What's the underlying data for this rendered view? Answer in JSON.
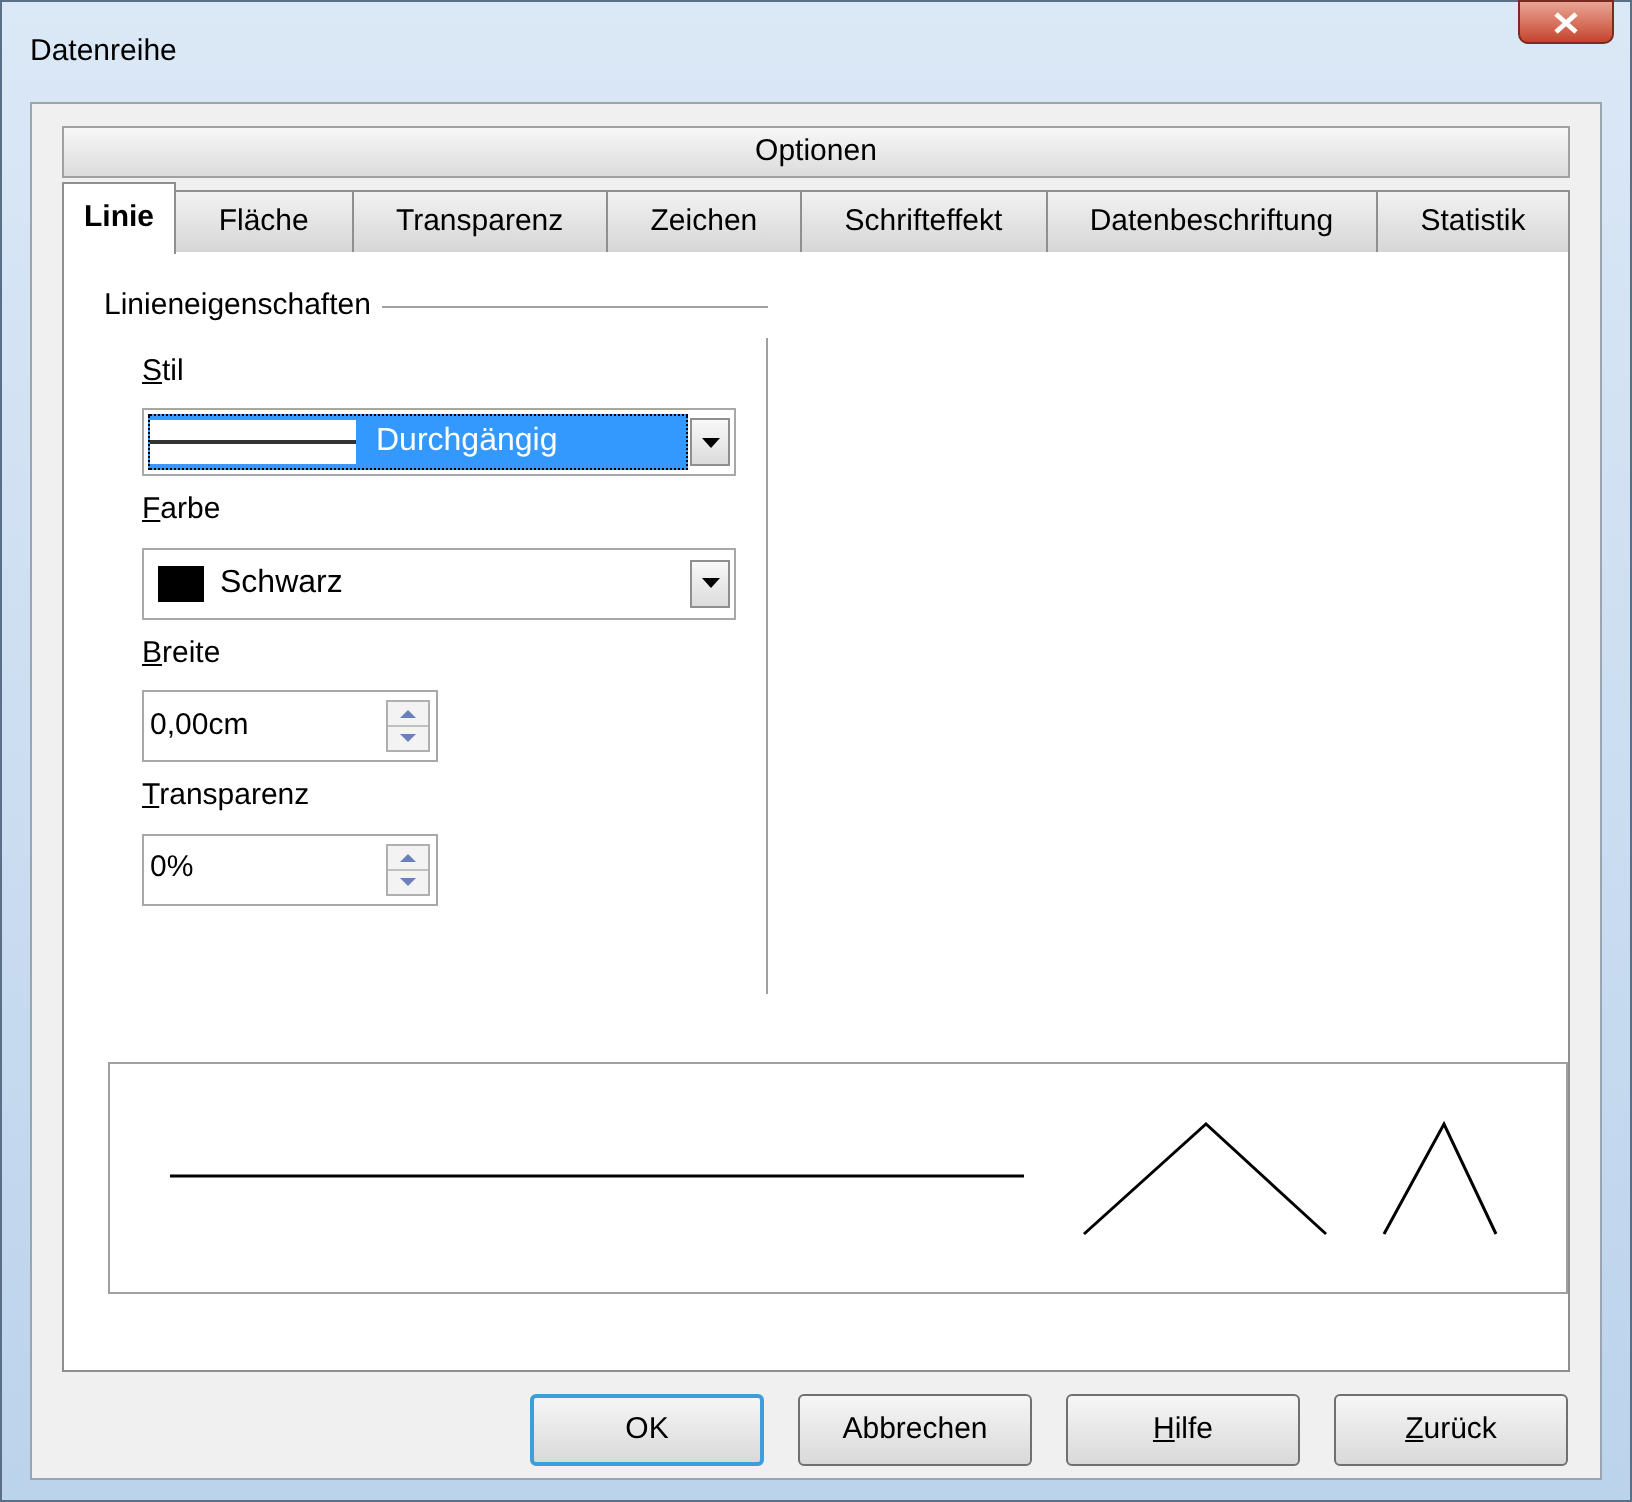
{
  "window": {
    "title": "Datenreihe"
  },
  "section_title": "Optionen",
  "tabs": [
    {
      "label": "Linie",
      "selected": true
    },
    {
      "label": "Fläche",
      "selected": false
    },
    {
      "label": "Transparenz",
      "selected": false
    },
    {
      "label": "Zeichen",
      "selected": false
    },
    {
      "label": "Schrifteffekt",
      "selected": false
    },
    {
      "label": "Datenbeschriftung",
      "selected": false
    },
    {
      "label": "Statistik",
      "selected": false
    }
  ],
  "group_title": "Linieneigenschaften",
  "fields": [
    {
      "kind": "style",
      "label": "Stil",
      "value": "Durchgängig"
    },
    {
      "kind": "color",
      "label": "Farbe",
      "value": "Schwarz",
      "color": "#000000"
    },
    {
      "kind": "spin",
      "label": "Breite",
      "value": "0,00cm"
    },
    {
      "kind": "spin",
      "label": "Transparenz",
      "value": "0%"
    }
  ],
  "buttons": [
    {
      "label": "OK",
      "default": true
    },
    {
      "label": "Abbrechen",
      "default": false
    },
    {
      "label": "Hilfe",
      "default": false
    },
    {
      "label": "Zurück",
      "default": false
    }
  ]
}
